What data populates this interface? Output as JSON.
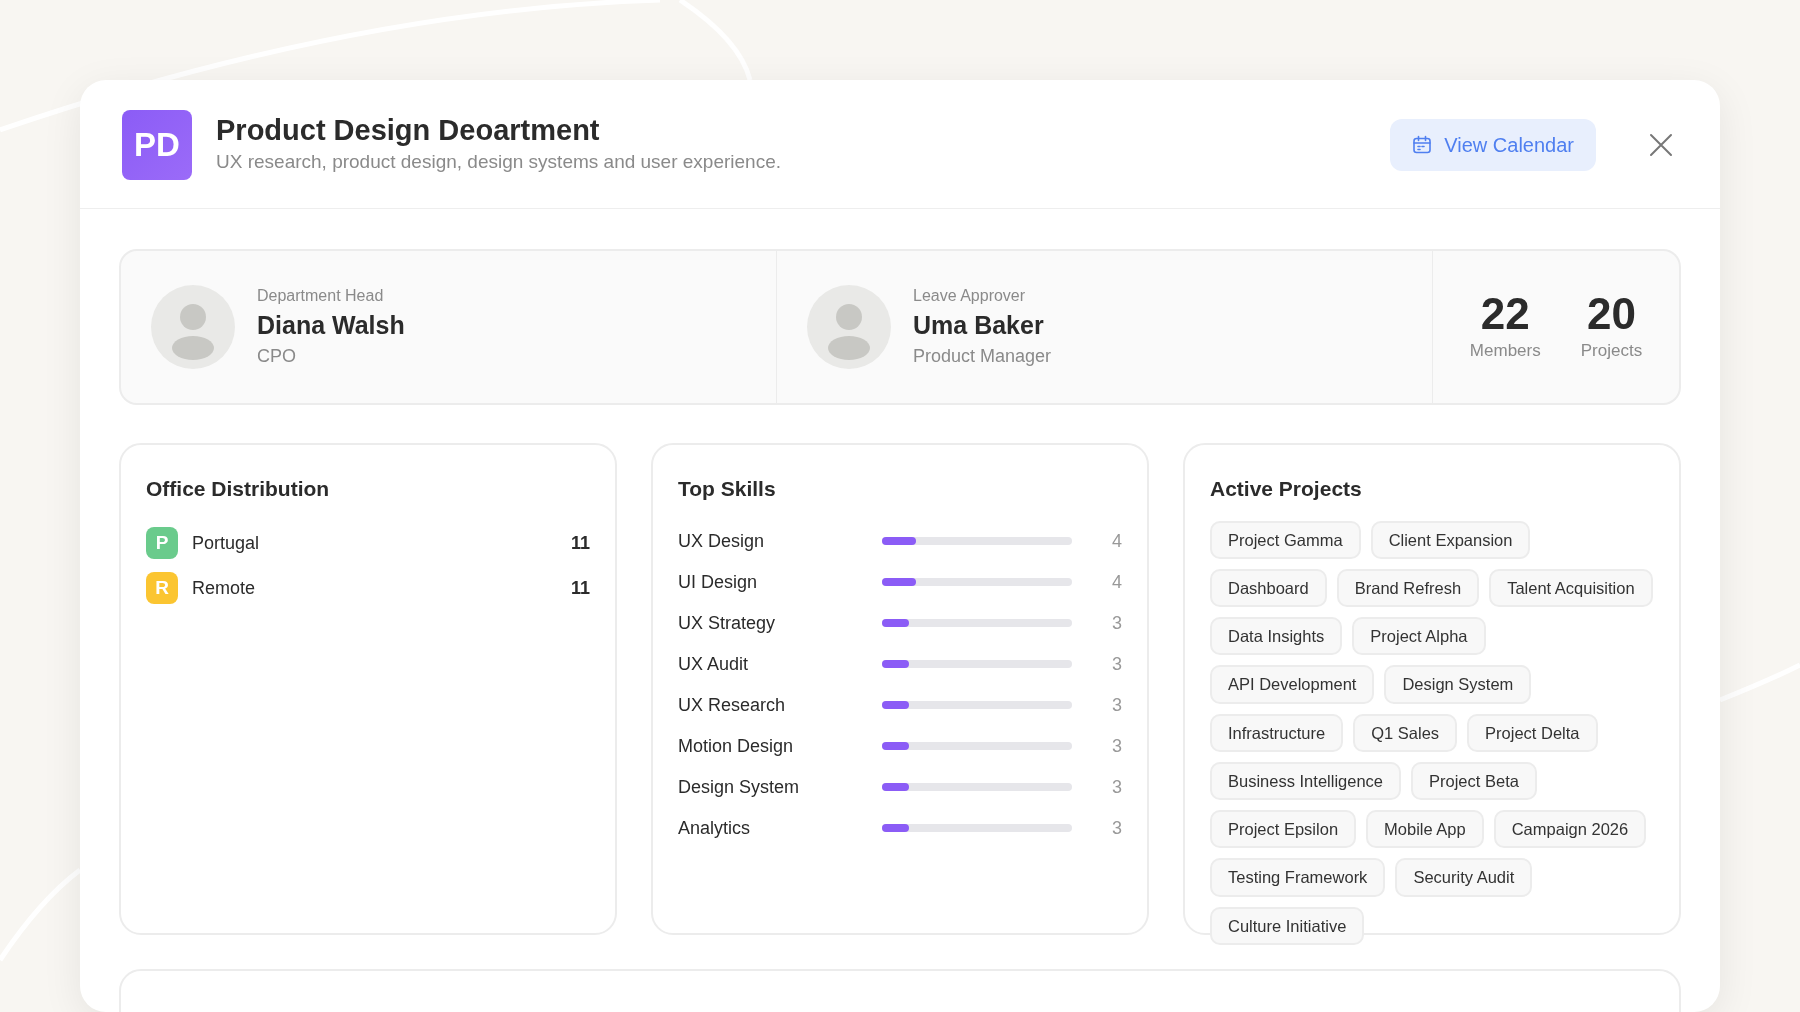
{
  "department": {
    "initials": "PD",
    "title": "Product Design Deoartment",
    "description": "UX research, product design, design systems and user experience."
  },
  "actions": {
    "calendar_button": "View Calendar"
  },
  "people": [
    {
      "role": "Department Head",
      "name": "Diana Walsh",
      "position": "CPO"
    },
    {
      "role": "Leave Approver",
      "name": "Uma Baker",
      "position": "Product Manager"
    }
  ],
  "stats": [
    {
      "value": "22",
      "label": "Members"
    },
    {
      "value": "20",
      "label": "Projects"
    }
  ],
  "office_distribution": {
    "title": "Office Distribution",
    "items": [
      {
        "initial": "P",
        "name": "Portugal",
        "count": "11",
        "color": "#6acb8c"
      },
      {
        "initial": "R",
        "name": "Remote",
        "count": "11",
        "color": "#fbc531"
      }
    ]
  },
  "top_skills": {
    "title": "Top Skills",
    "items": [
      {
        "name": "UX Design",
        "level": 0.18,
        "count": "4"
      },
      {
        "name": "UI Design",
        "level": 0.18,
        "count": "4"
      },
      {
        "name": "UX Strategy",
        "level": 0.14,
        "count": "3"
      },
      {
        "name": "UX Audit",
        "level": 0.14,
        "count": "3"
      },
      {
        "name": "UX Research",
        "level": 0.14,
        "count": "3"
      },
      {
        "name": "Motion Design",
        "level": 0.14,
        "count": "3"
      },
      {
        "name": "Design System",
        "level": 0.14,
        "count": "3"
      },
      {
        "name": "Analytics",
        "level": 0.14,
        "count": "3"
      }
    ]
  },
  "active_projects": {
    "title": "Active Projects",
    "tags": [
      "Project Gamma",
      "Client Expansion",
      "Dashboard",
      "Brand Refresh",
      "Talent Acquisition",
      "Data Insights",
      "Project Alpha",
      "API Development",
      "Design System",
      "Infrastructure",
      "Q1 Sales",
      "Project Delta",
      "Business Intelligence",
      "Project Beta",
      "Project Epsilon",
      "Mobile App",
      "Campaign 2026",
      "Testing Framework",
      "Security Audit",
      "Culture Initiative"
    ]
  }
}
